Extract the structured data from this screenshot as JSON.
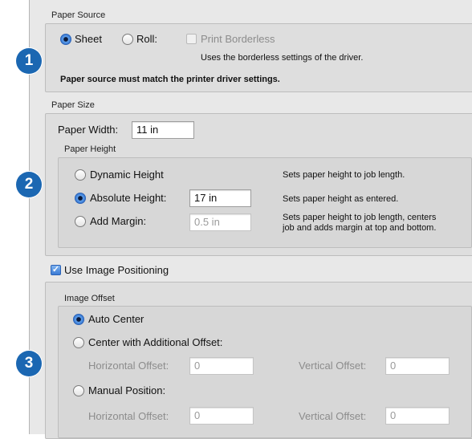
{
  "badges": [
    "1",
    "2",
    "3"
  ],
  "paper_source": {
    "title": "Paper Source",
    "options": [
      "Sheet",
      "Roll:"
    ],
    "selected": "Sheet",
    "print_borderless_label": "Print Borderless",
    "print_borderless_checked": false,
    "print_borderless_note": "Uses the borderless settings of the driver.",
    "warning": "Paper source must match the printer driver settings."
  },
  "paper_size": {
    "title": "Paper Size",
    "width_label": "Paper Width:",
    "width_value": "11 in",
    "height_group_title": "Paper Height",
    "options": [
      {
        "label": "Dynamic Height",
        "note": "Sets paper height to job length.",
        "selected": false
      },
      {
        "label": "Absolute Height:",
        "value": "17 in",
        "note": "Sets paper height as entered.",
        "selected": true
      },
      {
        "label": "Add Margin:",
        "value": "0.5 in",
        "note_line1": "Sets paper height to job length, centers",
        "note_line2": "job and adds margin at top and bottom.",
        "selected": false
      }
    ]
  },
  "image_positioning": {
    "checkbox_label": "Use Image Positioning",
    "checked": true,
    "offset_group_title": "Image Offset",
    "options": [
      {
        "label": "Auto Center",
        "selected": true
      },
      {
        "label": "Center with Additional Offset:",
        "selected": false,
        "horizontal_label": "Horizontal Offset:",
        "horizontal_value": "0",
        "vertical_label": "Vertical Offset:",
        "vertical_value": "0"
      },
      {
        "label": "Manual Position:",
        "selected": false,
        "horizontal_label": "Horizontal Offset:",
        "horizontal_value": "0",
        "vertical_label": "Vertical Offset:",
        "vertical_value": "0"
      }
    ]
  },
  "colors": {
    "accent": "#1b67b2",
    "panel": "#e8e8e8"
  }
}
